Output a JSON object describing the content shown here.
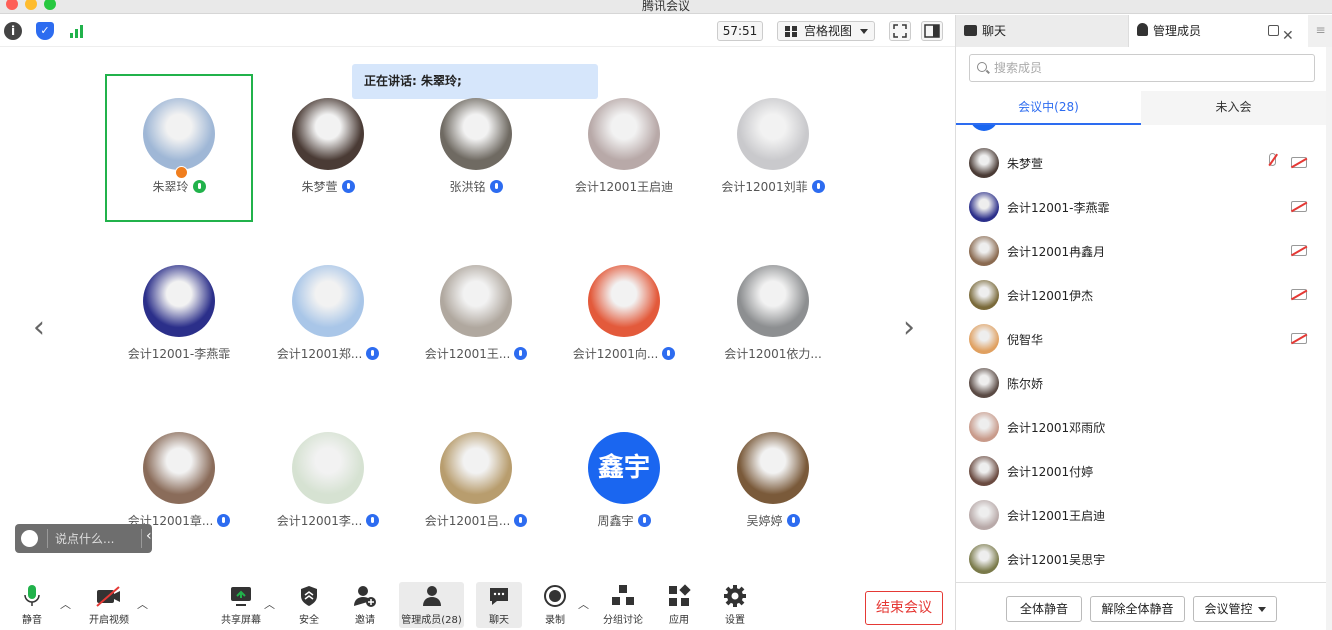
{
  "window": {
    "title": "腾讯会议"
  },
  "toolbar": {
    "timer": "57:51",
    "view_label": "宫格视图"
  },
  "speaking_banner": "正在讲话: 朱翠玲;",
  "grid": {
    "tiles": [
      {
        "name": "朱翠玲",
        "mic": "green",
        "active": true,
        "host": true,
        "color": "#9fb7d6"
      },
      {
        "name": "朱梦萱",
        "mic": "blue",
        "color": "#4a3b35"
      },
      {
        "name": "张洪铭",
        "mic": "blue",
        "color": "#6f6a62"
      },
      {
        "name": "会计12001王启迪",
        "mic": "none",
        "color": "#b8a9a8"
      },
      {
        "name": "会计12001刘菲",
        "mic": "blue",
        "color": "#c9c9cc"
      },
      {
        "name": "会计12001-李燕霏",
        "mic": "none",
        "color": "#2b2f8a"
      },
      {
        "name": "会计12001郑...",
        "mic": "blue",
        "color": "#a9c6e8"
      },
      {
        "name": "会计12001王...",
        "mic": "blue",
        "color": "#b0a89f"
      },
      {
        "name": "会计12001向...",
        "mic": "blue",
        "color": "#e35a3b"
      },
      {
        "name": "会计12001依力...",
        "mic": "none",
        "color": "#8d8f91"
      },
      {
        "name": "会计12001章...",
        "mic": "blue",
        "color": "#8a6c5a"
      },
      {
        "name": "会计12001李...",
        "mic": "blue",
        "color": "#d6e2d2"
      },
      {
        "name": "会计12001吕...",
        "mic": "blue",
        "color": "#b89d6e"
      },
      {
        "name": "周鑫宇",
        "mic": "blue",
        "color": "#1a66f0",
        "initials": "鑫宇"
      },
      {
        "name": "吴婷婷",
        "mic": "blue",
        "color": "#7a5a3a"
      }
    ]
  },
  "chat_input": {
    "placeholder": "说点什么..."
  },
  "bottombar": {
    "mute": "静音",
    "video": "开启视频",
    "share": "共享屏幕",
    "security": "安全",
    "invite": "邀请",
    "members": "管理成员(28)",
    "chat": "聊天",
    "record": "录制",
    "breakout": "分组讨论",
    "apps": "应用",
    "settings": "设置",
    "end": "结束会议"
  },
  "panel": {
    "tab_chat": "聊天",
    "tab_members": "管理成员",
    "search_placeholder": "搜索成员",
    "tab_in_meeting": "会议中(28)",
    "tab_not_joined": "未入会",
    "members": [
      {
        "name": "朱梦萱",
        "mic_off": true,
        "cam_off": true,
        "color": "#4a3b35"
      },
      {
        "name": "会计12001-李燕霏",
        "mic_off": false,
        "cam_off": true,
        "color": "#2b2f8a"
      },
      {
        "name": "会计12001冉鑫月",
        "mic_off": false,
        "cam_off": true,
        "color": "#8a6a50"
      },
      {
        "name": "会计12001伊杰",
        "mic_off": false,
        "cam_off": true,
        "color": "#7a6a3a"
      },
      {
        "name": "倪智华",
        "mic_off": false,
        "cam_off": true,
        "color": "#e0a060"
      },
      {
        "name": "陈尔娇",
        "mic_off": false,
        "cam_off": false,
        "color": "#5a4a44"
      },
      {
        "name": "会计12001邓雨欣",
        "mic_off": false,
        "cam_off": false,
        "color": "#c89a8a"
      },
      {
        "name": "会计12001付婷",
        "mic_off": false,
        "cam_off": false,
        "color": "#6a4a40"
      },
      {
        "name": "会计12001王启迪",
        "mic_off": false,
        "cam_off": false,
        "color": "#b8a9a8"
      },
      {
        "name": "会计12001吴思宇",
        "mic_off": false,
        "cam_off": false,
        "color": "#7a7a4a"
      }
    ],
    "btn_mute_all": "全体静音",
    "btn_unmute_all": "解除全体静音",
    "btn_control": "会议管控"
  }
}
